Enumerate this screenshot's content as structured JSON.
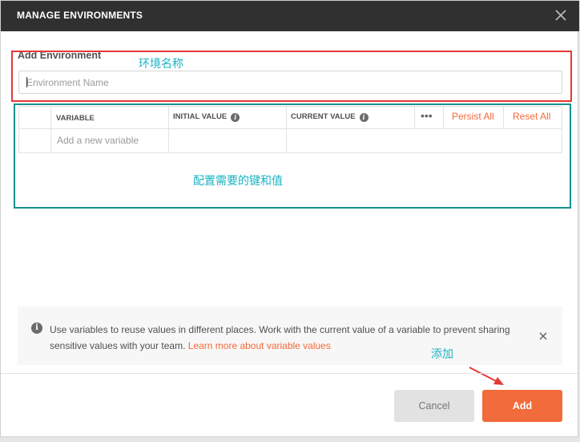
{
  "dialog": {
    "title": "MANAGE ENVIRONMENTS"
  },
  "environment": {
    "section_label": "Add Environment",
    "name_placeholder": "Environment Name",
    "name_value": ""
  },
  "variables_table": {
    "headers": [
      "VARIABLE",
      "INITIAL VALUE",
      "CURRENT VALUE"
    ],
    "more_icon": "more-horizontal-icon",
    "persist_all_label": "Persist All",
    "reset_all_label": "Reset All",
    "new_row_placeholder": "Add a new variable"
  },
  "notice": {
    "text": "Use variables to reuse values in different places. Work with the current value of a variable to prevent sharing sensitive values with your team.",
    "link_text": "Learn more about variable values"
  },
  "footer": {
    "cancel_label": "Cancel",
    "add_label": "Add"
  },
  "annotations": {
    "env_name_note": "环境名称",
    "table_note": "配置需要的键和值",
    "add_note": "添加"
  },
  "colors": {
    "accent": "#f26b3a",
    "titlebar": "#303030",
    "annotation_red": "#e53935",
    "annotation_teal": "#16918a",
    "annotation_text": "#19b3c5"
  }
}
